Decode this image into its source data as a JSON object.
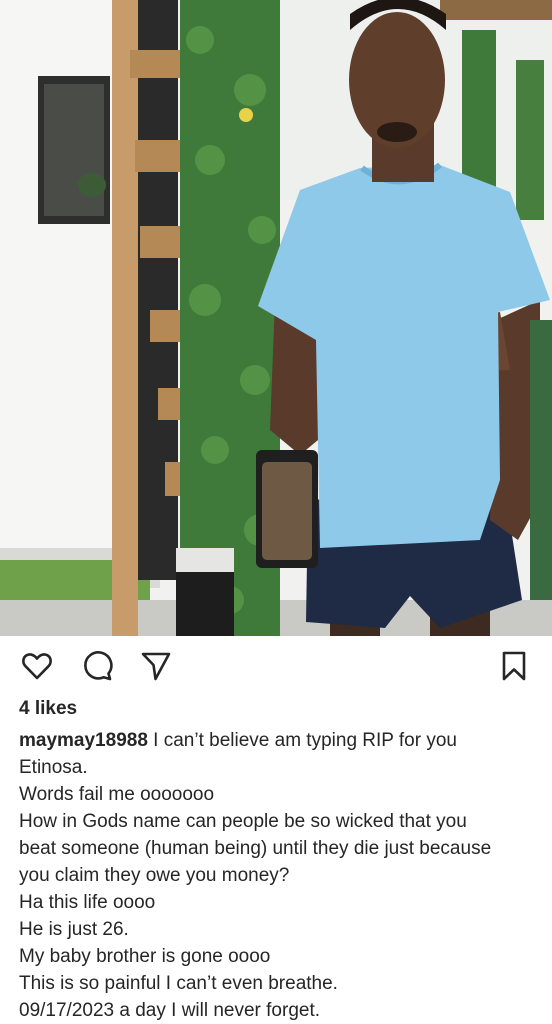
{
  "post": {
    "image_alt": "Photo of a man in a light blue t-shirt and navy shorts standing by a vertical green hedge wall",
    "likes": "4 likes",
    "username": "maymay18988",
    "caption_first": "I can’t believe am typing RIP for you",
    "caption_lines": [
      "Etinosa.",
      "Words fail me ooooooo",
      "How in Gods name can people be so wicked that you",
      "beat someone (human being) until they die just because",
      "you claim they owe you money?",
      "Ha this life oooo",
      "He is just 26.",
      "My baby brother is gone oooo",
      "This is so painful I can’t even breathe.",
      "09/17/2023 a day I will never forget."
    ]
  },
  "actions": {
    "like_icon": "heart-icon",
    "comment_icon": "comment-bubble-icon",
    "share_icon": "paper-plane-icon",
    "save_icon": "bookmark-icon"
  },
  "colors": {
    "text": "#262626",
    "shirt": "#8ec9ea",
    "hedge": "#3f7a3a",
    "wall": "#f4f4f2"
  }
}
